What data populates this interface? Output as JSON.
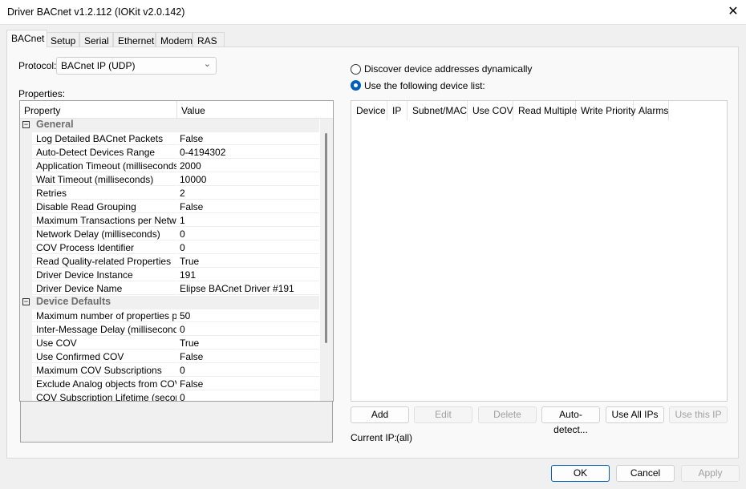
{
  "window": {
    "title": "Driver BACnet v1.2.112 (IOKit v2.0.142)",
    "close_icon": "close-icon"
  },
  "tabs": [
    "BACnet",
    "Setup",
    "Serial",
    "Ethernet",
    "Modem",
    "RAS"
  ],
  "active_tab": "BACnet",
  "protocol": {
    "label": "Protocol:",
    "value": "BACnet IP (UDP)"
  },
  "properties": {
    "label": "Properties:",
    "headers": [
      "Property",
      "Value"
    ],
    "categories": [
      {
        "name": "General",
        "items": [
          [
            "Log Detailed BACnet Packets",
            "False"
          ],
          [
            "Auto-Detect Devices Range",
            "0-4194302"
          ],
          [
            "Application Timeout (milliseconds)",
            "2000"
          ],
          [
            "Wait Timeout (milliseconds)",
            "10000"
          ],
          [
            "Retries",
            "2"
          ],
          [
            "Disable Read Grouping",
            "False"
          ],
          [
            "Maximum Transactions per Network",
            "1"
          ],
          [
            "Network Delay (milliseconds)",
            "0"
          ],
          [
            "COV Process Identifier",
            "0"
          ],
          [
            "Read Quality-related Properties",
            "True"
          ],
          [
            "Driver Device Instance",
            "191"
          ],
          [
            "Driver Device Name",
            "Elipse BACnet Driver #191"
          ]
        ]
      },
      {
        "name": "Device Defaults",
        "items": [
          [
            "Maximum number of properties per...",
            "50"
          ],
          [
            "Inter-Message Delay (milliseconds)",
            "0"
          ],
          [
            "Use COV",
            "True"
          ],
          [
            "Use Confirmed COV",
            "False"
          ],
          [
            "Maximum COV Subscriptions",
            "0"
          ],
          [
            "Exclude Analog objects from COV",
            "False"
          ],
          [
            "COV Subscription Lifetime (secon...",
            "0"
          ]
        ]
      }
    ]
  },
  "discovery": {
    "dynamic_label": "Discover device addresses dynamically",
    "list_label": "Use the following device list:",
    "selected": "list"
  },
  "device_list": {
    "headers": [
      "Device",
      "IP",
      "Subnet/MAC",
      "Use COV",
      "Read Multiple",
      "Write Priority",
      "Alarms"
    ],
    "rows": []
  },
  "list_buttons": [
    {
      "label": "Add",
      "enabled": true
    },
    {
      "label": "Edit",
      "enabled": false
    },
    {
      "label": "Delete",
      "enabled": false
    },
    {
      "label": "Auto-detect...",
      "enabled": true
    },
    {
      "label": "Use All IPs",
      "enabled": true
    },
    {
      "label": "Use this IP",
      "enabled": false
    }
  ],
  "current_ip": {
    "label": "Current IP:",
    "value": "(all)"
  },
  "dialog_buttons": {
    "ok": "OK",
    "cancel": "Cancel",
    "apply": "Apply"
  },
  "colors": {
    "accent": "#005fb8"
  }
}
